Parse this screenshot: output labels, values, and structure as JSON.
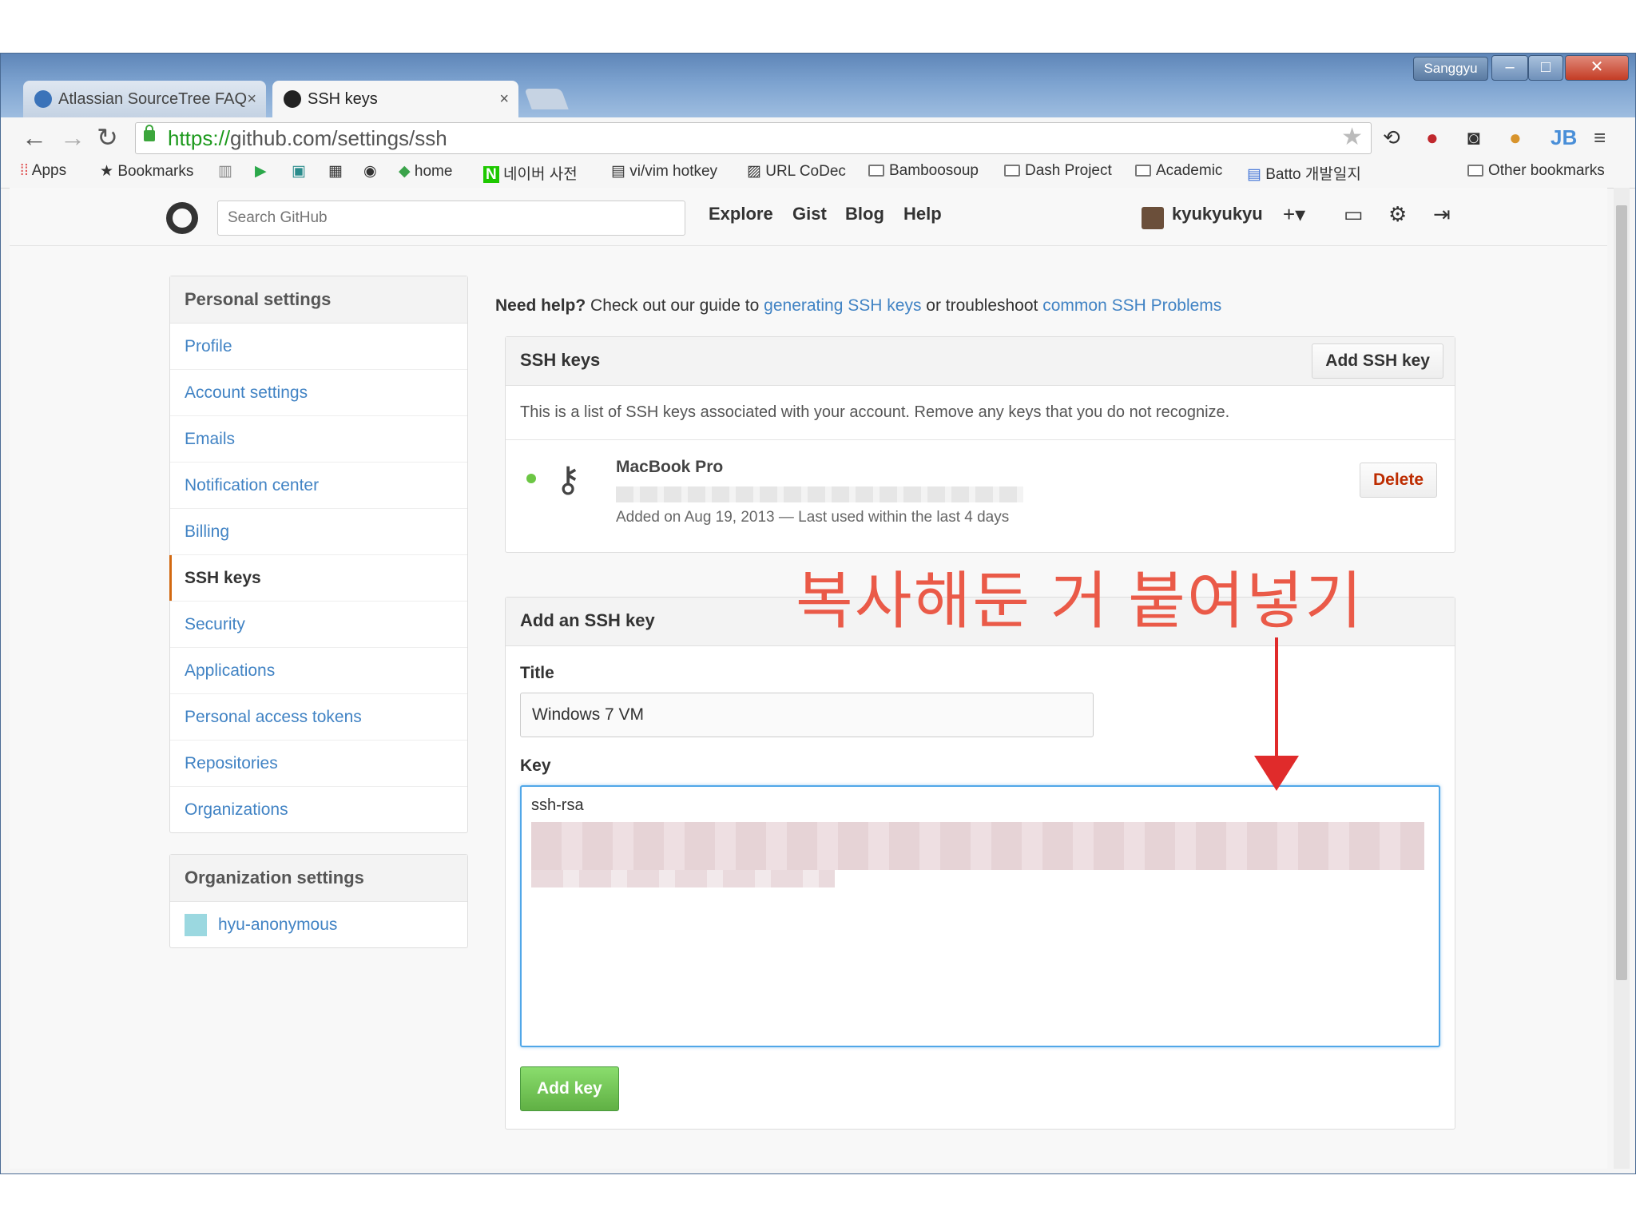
{
  "window": {
    "user_badge": "Sanggyu",
    "tabs": [
      {
        "title": "Atlassian SourceTree FAQ",
        "active": false
      },
      {
        "title": "SSH keys",
        "active": true
      }
    ],
    "close_glyph": "×"
  },
  "toolbar": {
    "url_scheme": "https://",
    "url_rest": "github.com/settings/ssh"
  },
  "bookmarks": {
    "apps": "Apps",
    "bookmarks": "Bookmarks",
    "home": "home",
    "naver": "네이버 사전",
    "vim": "vi/vim hotkey",
    "urlcodec": "URL CoDec",
    "bamboo": "Bamboosoup",
    "dash": "Dash Project",
    "academic": "Academic",
    "batto": "Batto 개발일지",
    "other": "Other bookmarks"
  },
  "github_header": {
    "search_placeholder": "Search GitHub",
    "nav": [
      "Explore",
      "Gist",
      "Blog",
      "Help"
    ],
    "username": "kyukyukyu"
  },
  "sidebar": {
    "personal_heading": "Personal settings",
    "items": [
      {
        "label": "Profile"
      },
      {
        "label": "Account settings"
      },
      {
        "label": "Emails"
      },
      {
        "label": "Notification center"
      },
      {
        "label": "Billing"
      },
      {
        "label": "SSH keys",
        "selected": true
      },
      {
        "label": "Security"
      },
      {
        "label": "Applications"
      },
      {
        "label": "Personal access tokens"
      },
      {
        "label": "Repositories"
      },
      {
        "label": "Organizations"
      }
    ],
    "org_heading": "Organization settings",
    "org_name": "hyu-anonymous"
  },
  "main": {
    "help_bold": "Need help?",
    "help_text1": " Check out our guide to ",
    "help_link1": "generating SSH keys",
    "help_text2": " or troubleshoot ",
    "help_link2": "common SSH Problems",
    "ssh_box_title": "SSH keys",
    "add_ssh_button": "Add SSH key",
    "ssh_description": "This is a list of SSH keys associated with your account. Remove any keys that you do not recognize.",
    "key": {
      "name": "MacBook Pro",
      "meta": "Added on Aug 19, 2013 — Last used within the last 4 days",
      "delete_label": "Delete"
    },
    "add_box_title": "Add an SSH key",
    "title_label": "Title",
    "title_value": "Windows 7 VM",
    "key_label": "Key",
    "key_value_start": "ssh-rsa",
    "add_key_button": "Add key"
  },
  "annotation": {
    "text": "복사해둔 거 붙여넣기",
    "color": "#ea5a48"
  }
}
